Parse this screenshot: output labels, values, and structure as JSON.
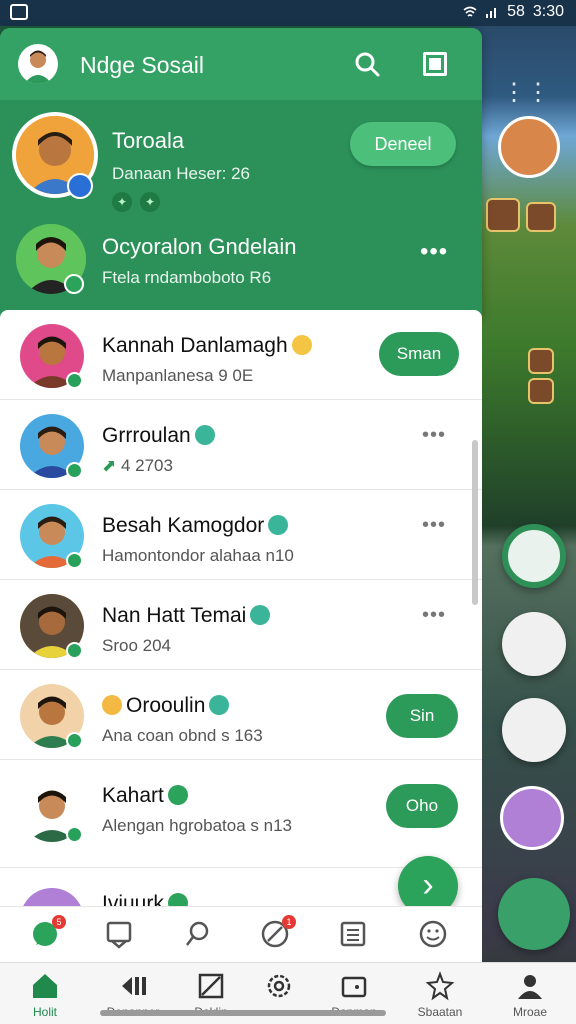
{
  "status_bar": {
    "time": "3:30",
    "network": "58"
  },
  "header": {
    "title": "Ndge Sosail",
    "accent": "#33a264"
  },
  "featured": {
    "name": "Toroala",
    "subtitle": "Danaan Heser: 26",
    "button_label": "Deneel"
  },
  "second": {
    "name": "Ocyoralon Gndelain",
    "subtitle": "Ftela rndamboboto R6",
    "more": "•••"
  },
  "contacts": [
    {
      "name": "Kannah Danlamagh",
      "subtitle": "Manpanlanesa 9 0E",
      "action": "Sman"
    },
    {
      "name": "Grrroulan",
      "subtitle": "4 2703",
      "action": "•••"
    },
    {
      "name": "Besah Kamogdor",
      "subtitle": "Hamontondor alahaa n10",
      "action": "•••"
    },
    {
      "name": "Nan Hatt Temai",
      "subtitle": "Sroo 204",
      "action": "•••"
    },
    {
      "name": "Orooulin",
      "subtitle": "Ana coan obnd s 163",
      "action": "Sin"
    },
    {
      "name": "Kahart",
      "subtitle": "Alengan hgrobatoa s n13",
      "action": "Oho"
    },
    {
      "name": "Iviuurk",
      "subtitle": "",
      "action": ""
    }
  ],
  "fab": {
    "symbol": "›"
  },
  "tab_icons": [
    "chat-icon",
    "inbox-icon",
    "pin-icon",
    "compass-icon",
    "list-icon",
    "smiley-icon"
  ],
  "tab_badges": {
    "chat": "5",
    "compass": "1"
  },
  "bottom_nav": [
    {
      "label": "Holit",
      "icon": "home-icon",
      "active": true
    },
    {
      "label": "Denanner",
      "icon": "rewind-icon"
    },
    {
      "label": "Daklin",
      "icon": "edit-icon"
    },
    {
      "label": "",
      "icon": "settings-icon"
    },
    {
      "label": "Danman",
      "icon": "wallet-icon"
    },
    {
      "label": "Sbaatan",
      "icon": "flower-icon"
    },
    {
      "label": "Mroae",
      "icon": "person-icon"
    }
  ]
}
